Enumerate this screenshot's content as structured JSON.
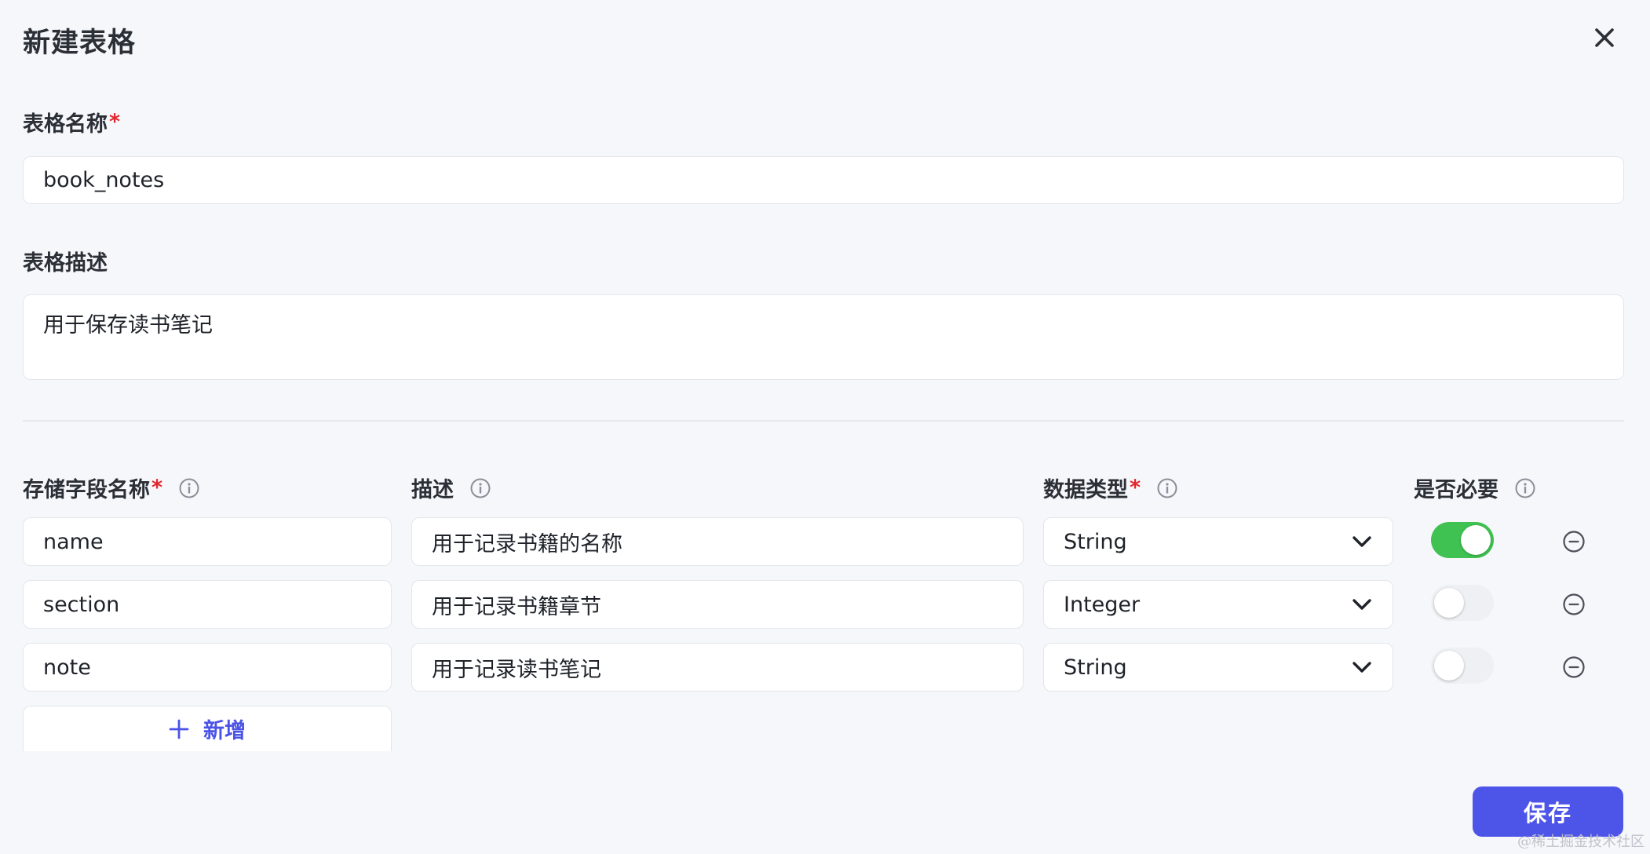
{
  "dialog": {
    "title": "新建表格",
    "close_icon": "close-icon"
  },
  "table_name": {
    "label": "表格名称",
    "required_mark": "*",
    "value": "book_notes"
  },
  "table_desc": {
    "label": "表格描述",
    "value": "用于保存读书笔记"
  },
  "fields": {
    "headers": {
      "name": "存储字段名称",
      "name_required": "*",
      "desc": "描述",
      "type": "数据类型",
      "type_required": "*",
      "required": "是否必要"
    },
    "rows": [
      {
        "name": "name",
        "desc": "用于记录书籍的名称",
        "type": "String",
        "required": true
      },
      {
        "name": "section",
        "desc": "用于记录书籍章节",
        "type": "Integer",
        "required": false
      },
      {
        "name": "note",
        "desc": "用于记录读书笔记",
        "type": "String",
        "required": false
      }
    ],
    "add_label": "新增"
  },
  "actions": {
    "save_label": "保存"
  },
  "watermark": "@稀土掘金技术社区",
  "colors": {
    "accent": "#4d54e8",
    "toggle_on": "#3fc251",
    "required": "#e5242b"
  }
}
